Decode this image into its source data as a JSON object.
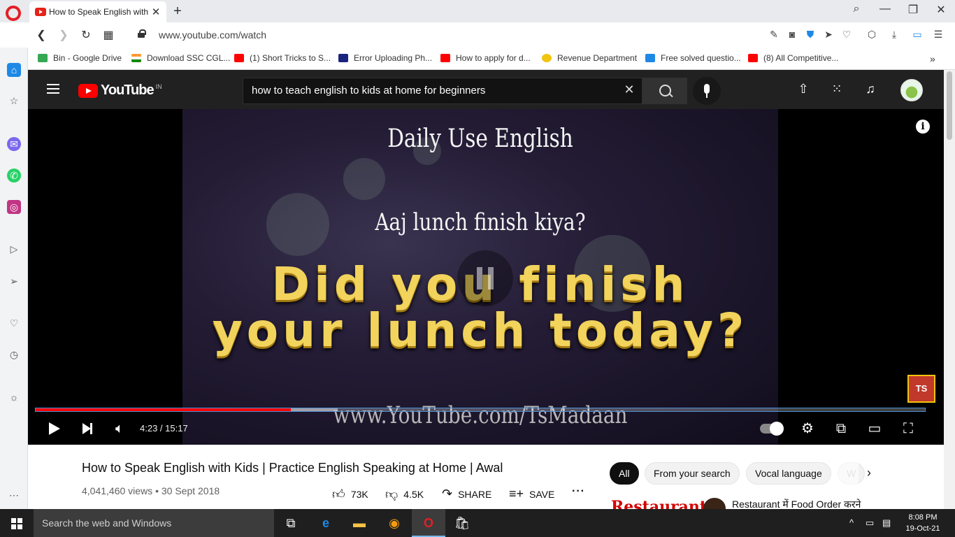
{
  "browser": {
    "tab_title": "How to Speak English with",
    "new_tab": "+",
    "url": "www.youtube.com/watch",
    "bookmarks": [
      {
        "label": "Bin - Google Drive",
        "color": "#34a853"
      },
      {
        "label": "Download SSC CGL...",
        "color": "#ff9933"
      },
      {
        "label": "(1) Short Tricks to S...",
        "color": "#ff0000"
      },
      {
        "label": "Error Uploading Ph...",
        "color": "#1a237e"
      },
      {
        "label": "How to apply for d...",
        "color": "#ff0000"
      },
      {
        "label": "Revenue Department",
        "color": "#f1c40f"
      },
      {
        "label": "Free solved questio...",
        "color": "#1e88e5"
      },
      {
        "label": "(8) All Competitive...",
        "color": "#ff0000"
      }
    ]
  },
  "youtube": {
    "logo_text": "YouTube",
    "country_code": "IN",
    "search_query": "how to teach english to kids at home for beginners"
  },
  "video": {
    "overlay_text_1": "Daily Use English",
    "overlay_text_2": "Aaj lunch finish kiya?",
    "overlay_text_3": "Did you finish",
    "overlay_text_4": "your lunch today?",
    "overlay_text_5": "www.YouTube.com/TsMadaan",
    "channel_logo": "TS",
    "time": "4:23 / 15:17",
    "played_fraction": 0.287,
    "loaded_fraction": 0.34,
    "title": "How to Speak English with Kids | Practice English Speaking at Home | Awal",
    "meta": "4,041,460 views • 30 Sept 2018",
    "likes": "73K",
    "dislikes": "4.5K",
    "share": "SHARE",
    "save": "SAVE"
  },
  "chips": [
    "All",
    "From your search",
    "Vocal language",
    "W"
  ],
  "recommendation": {
    "thumb_text": "Restaurant",
    "title": "Restaurant में Food Order करने"
  },
  "taskbar": {
    "search_placeholder": "Search the web and Windows",
    "time": "8:08 PM",
    "date": "19-Oct-21"
  }
}
